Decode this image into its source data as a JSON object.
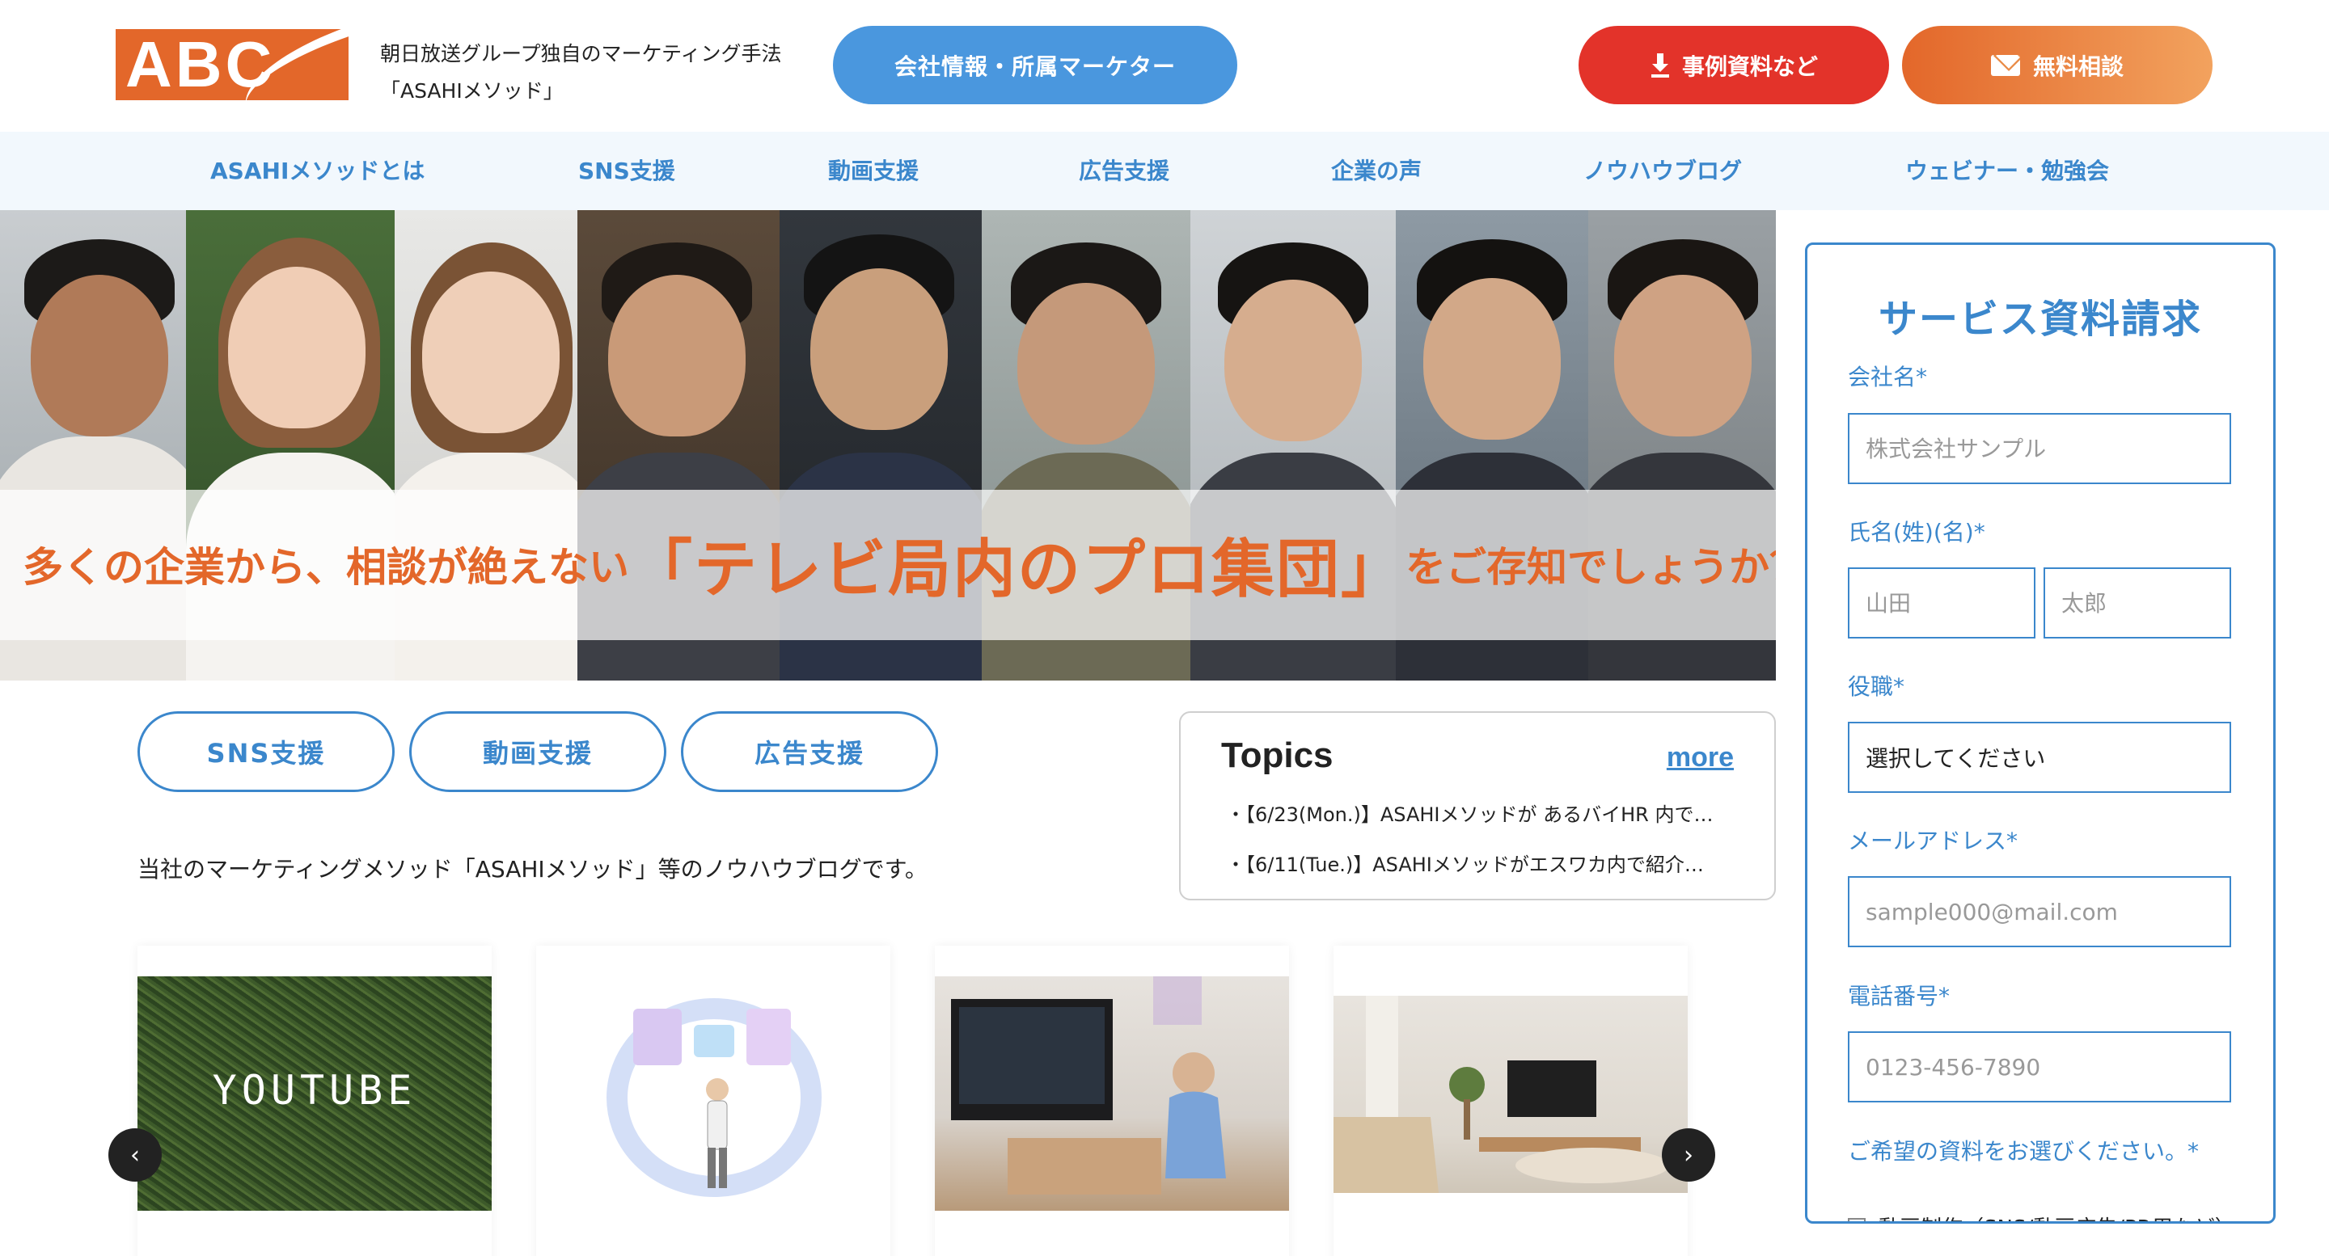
{
  "header": {
    "logo_text": "ABC",
    "tagline_line1": "朝日放送グループ独自のマーケティング手法",
    "tagline_line2": "「ASAHIメソッド」",
    "company_button": "会社情報・所属マーケター",
    "cases_button": "事例資料など",
    "consult_button": "無料相談",
    "cases_icon": "download-icon",
    "consult_icon": "mail-icon"
  },
  "nav": {
    "items": [
      {
        "label": "ASAHIメソッドとは"
      },
      {
        "label": "SNS支援"
      },
      {
        "label": "動画支援"
      },
      {
        "label": "広告支援"
      },
      {
        "label": "企業の声"
      },
      {
        "label": "ノウハウブログ"
      },
      {
        "label": "ウェビナー・勉強会"
      }
    ]
  },
  "hero": {
    "text_before": "多くの企業から、相談が絶えない",
    "text_emphasis": "「テレビ局内のプロ集団」",
    "text_after": "をご存知でしょうか？"
  },
  "services": {
    "sns": "SNS支援",
    "video": "動画支援",
    "ads": "広告支援"
  },
  "description": "当社のマーケティングメソッド「ASAHIメソッド」等のノウハウブログです。",
  "topics": {
    "title": "Topics",
    "more": "more",
    "items": [
      {
        "text": "【6/23(Mon.)】ASAHIメソッドが あるバイHR 内で…"
      },
      {
        "text": "【6/11(Tue.)】ASAHIメソッドがエスワカ内で紹介…"
      }
    ]
  },
  "cards": {
    "youtube_image_text": "YOUTUBE",
    "prev_label": "‹",
    "next_label": "›"
  },
  "form": {
    "title": "サービス資料請求",
    "company_label": "会社名*",
    "company_placeholder": "株式会社サンプル",
    "name_label": "氏名(姓)(名)*",
    "last_name_placeholder": "山田",
    "first_name_placeholder": "太郎",
    "position_label": "役職*",
    "position_selected": "選択してください",
    "email_label": "メールアドレス*",
    "email_placeholder": "sample000@mail.com",
    "phone_label": "電話番号*",
    "phone_placeholder": "0123-456-7890",
    "materials_label": "ご希望の資料をお選びください。*",
    "materials_option1": "動画制作（SNS/動画広告/PR用など）"
  },
  "colors": {
    "brand_orange": "#e3672a",
    "accent_blue": "#3b87cc",
    "cases_red": "#e3332a"
  }
}
